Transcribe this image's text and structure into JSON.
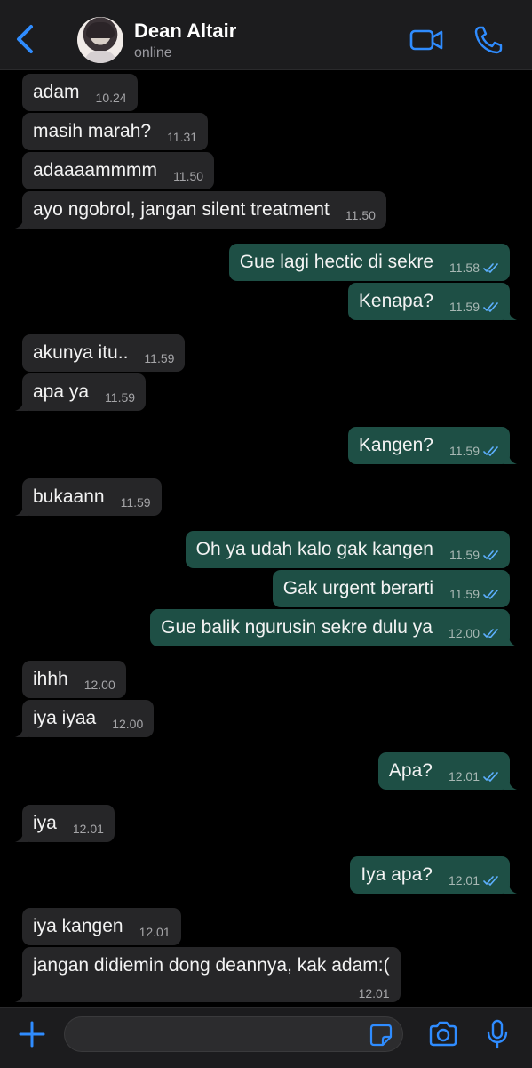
{
  "header": {
    "name": "Dean Altair",
    "status": "online"
  },
  "icons": {
    "back": "chevron-left-icon",
    "video": "video-camera-icon",
    "call": "phone-icon",
    "add": "plus-icon",
    "sticker": "sticker-icon",
    "camera": "camera-icon",
    "mic": "microphone-icon"
  },
  "colors": {
    "accent": "#2f8cff",
    "incoming_bubble": "#262628",
    "outgoing_bubble": "#1e4f45",
    "read_ticks": "#5db0ff"
  },
  "messages": [
    {
      "dir": "in",
      "text": "adam",
      "time": "10.24"
    },
    {
      "dir": "in",
      "text": "masih marah?",
      "time": "11.31"
    },
    {
      "dir": "in",
      "text": "adaaaammmm",
      "time": "11.50"
    },
    {
      "dir": "in",
      "text": "ayo ngobrol, jangan silent treatment",
      "time": "11.50"
    },
    {
      "dir": "out",
      "text": "Gue lagi hectic di sekre",
      "time": "11.58",
      "read": true
    },
    {
      "dir": "out",
      "text": "Kenapa?",
      "time": "11.59",
      "read": true
    },
    {
      "dir": "in",
      "text": "akunya itu..",
      "time": "11.59"
    },
    {
      "dir": "in",
      "text": "apa ya",
      "time": "11.59"
    },
    {
      "dir": "out",
      "text": "Kangen?",
      "time": "11.59",
      "read": true
    },
    {
      "dir": "in",
      "text": "bukaann",
      "time": "11.59"
    },
    {
      "dir": "out",
      "text": "Oh ya udah kalo gak kangen",
      "time": "11.59",
      "read": true
    },
    {
      "dir": "out",
      "text": "Gak urgent berarti",
      "time": "11.59",
      "read": true
    },
    {
      "dir": "out",
      "text": "Gue balik ngurusin sekre dulu ya",
      "time": "12.00",
      "read": true
    },
    {
      "dir": "in",
      "text": "ihhh",
      "time": "12.00"
    },
    {
      "dir": "in",
      "text": "iya iyaa",
      "time": "12.00"
    },
    {
      "dir": "out",
      "text": "Apa?",
      "time": "12.01",
      "read": true
    },
    {
      "dir": "in",
      "text": "iya",
      "time": "12.01"
    },
    {
      "dir": "out",
      "text": "Iya apa?",
      "time": "12.01",
      "read": true
    },
    {
      "dir": "in",
      "text": "iya kangen",
      "time": "12.01"
    },
    {
      "dir": "in",
      "text": "jangan didiemin dong deannya, kak adam:(",
      "time": "12.01"
    }
  ],
  "composer": {
    "input_value": "",
    "input_placeholder": ""
  }
}
